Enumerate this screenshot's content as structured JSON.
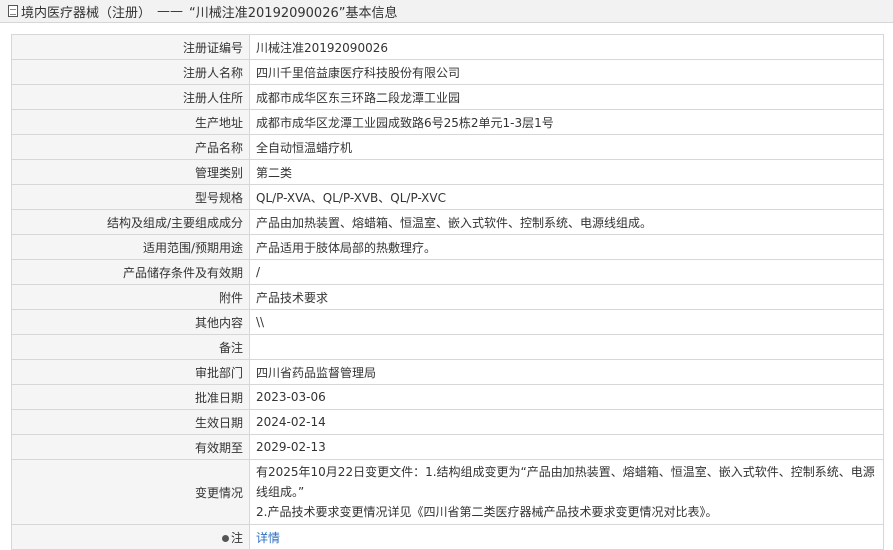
{
  "header": {
    "category": "境内医疗器械（注册）",
    "separator": "——",
    "title": "“川械注准20192090026”基本信息"
  },
  "rows": [
    {
      "label": "注册证编号",
      "value": "川械注准20192090026"
    },
    {
      "label": "注册人名称",
      "value": "四川千里倍益康医疗科技股份有限公司"
    },
    {
      "label": "注册人住所",
      "value": "成都市成华区东三环路二段龙潭工业园"
    },
    {
      "label": "生产地址",
      "value": "成都市成华区龙潭工业园成致路6号25栋2单元1-3层1号"
    },
    {
      "label": "产品名称",
      "value": "全自动恒温蜡疗机"
    },
    {
      "label": "管理类别",
      "value": "第二类"
    },
    {
      "label": "型号规格",
      "value": "QL/P-XVA、QL/P-XVB、QL/P-XVC"
    },
    {
      "label": "结构及组成/主要组成成分",
      "value": "产品由加热装置、熔蜡箱、恒温室、嵌入式软件、控制系统、电源线组成。"
    },
    {
      "label": "适用范围/预期用途",
      "value": "产品适用于肢体局部的热敷理疗。"
    },
    {
      "label": "产品储存条件及有效期",
      "value": "/"
    },
    {
      "label": "附件",
      "value": "产品技术要求"
    },
    {
      "label": "其他内容",
      "value": "\\\\"
    },
    {
      "label": "备注",
      "value": ""
    },
    {
      "label": "审批部门",
      "value": "四川省药品监督管理局"
    },
    {
      "label": "批准日期",
      "value": "2023-03-06"
    },
    {
      "label": "生效日期",
      "value": "2024-02-14"
    },
    {
      "label": "有效期至",
      "value": "2029-02-13"
    },
    {
      "label": "变更情况",
      "value_line1": "有2025年10月22日变更文件：1.结构组成变更为“产品由加热装置、熔蜡箱、恒温室、嵌入式软件、控制系统、电源线组成。”",
      "value_line2": "2.产品技术要求变更情况详见《四川省第二类医疗器械产品技术要求变更情况对比表》。"
    },
    {
      "label": "注",
      "value": "详情"
    }
  ],
  "icons": {
    "header": "document-icon",
    "note": "pin-icon"
  }
}
